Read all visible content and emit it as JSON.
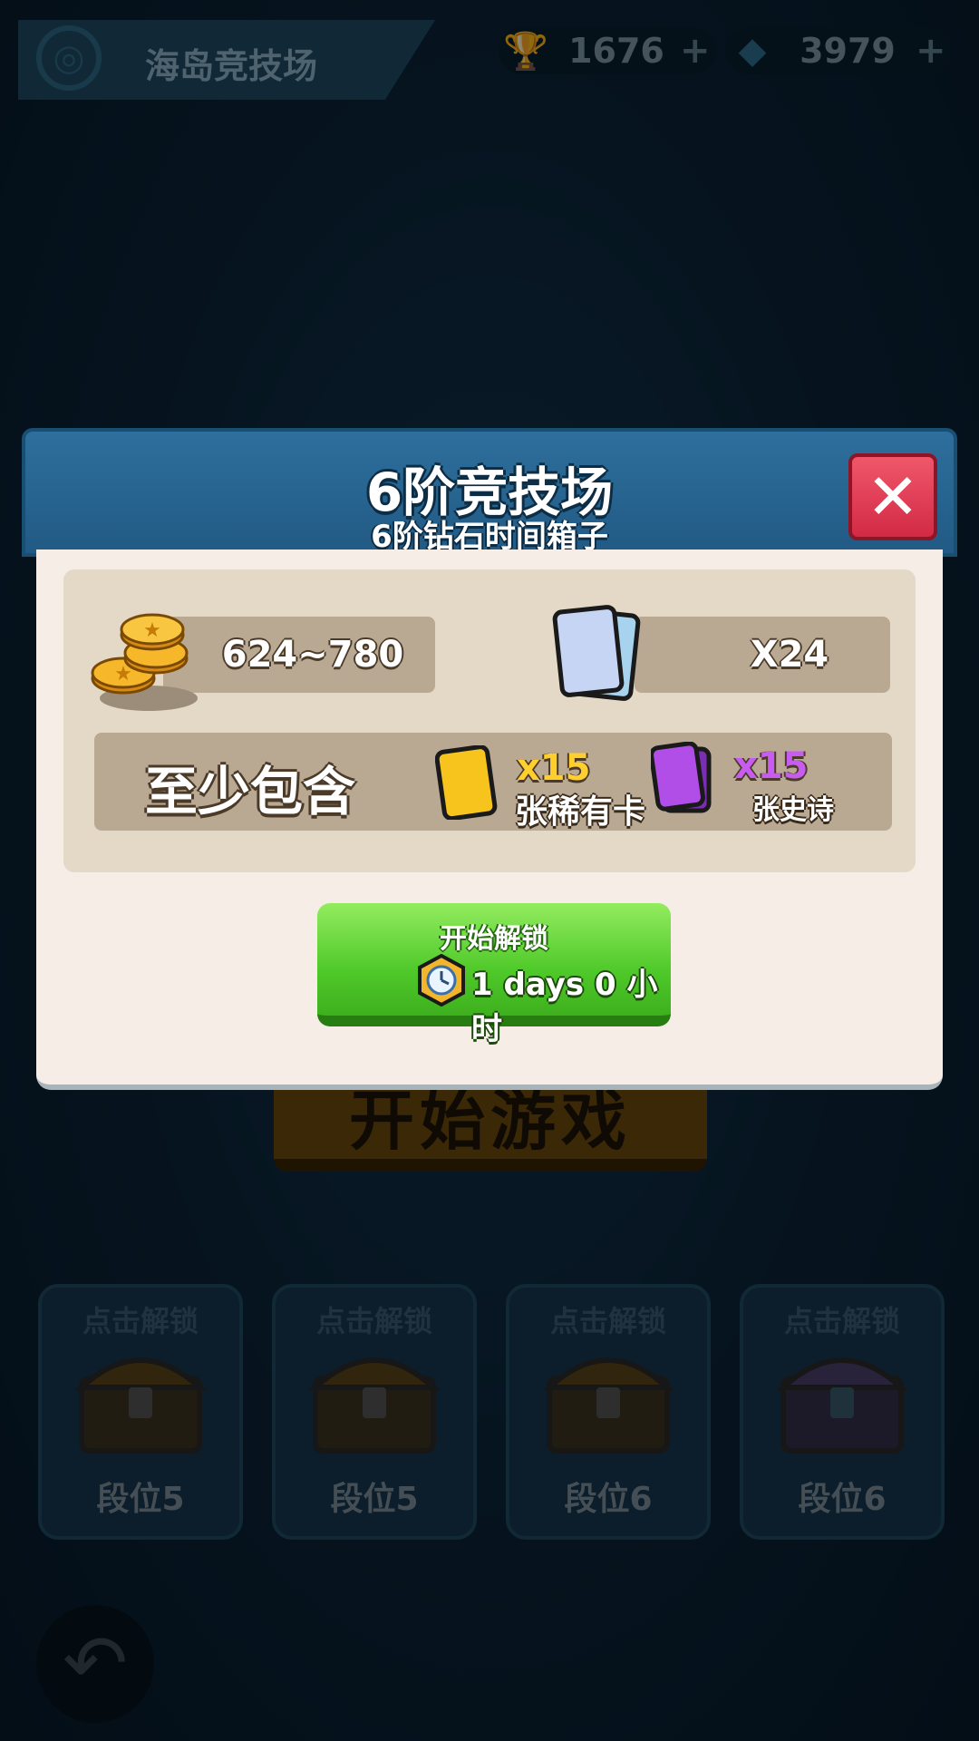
{
  "top_bar": {
    "arena_name": "海岛竞技场",
    "trophies": "1676",
    "gems": "3979",
    "plus_symbol": "+"
  },
  "background": {
    "start_game_label": "开始游戏",
    "chest_slots": [
      {
        "unlock_label": "点击解锁",
        "tier": "段位5",
        "chest_type": "wooden"
      },
      {
        "unlock_label": "点击解锁",
        "tier": "段位5",
        "chest_type": "wooden"
      },
      {
        "unlock_label": "点击解锁",
        "tier": "段位6",
        "chest_type": "wooden"
      },
      {
        "unlock_label": "点击解锁",
        "tier": "段位6",
        "chest_type": "diamond"
      }
    ]
  },
  "dialog": {
    "title": "6阶竞技场",
    "subtitle": "6阶钻石时间箱子",
    "close_symbol": "✕",
    "gold_range": "624~780",
    "card_count": "X24",
    "at_least_label": "至少包含",
    "rare": {
      "qty": "x15",
      "label": "张稀有卡",
      "color": "#ffcf2e"
    },
    "epic": {
      "qty": "x15",
      "label": "张史诗",
      "color": "#c85cf2"
    },
    "unlock_button": {
      "label": "开始解锁",
      "duration": "1 days 0 小时"
    }
  }
}
